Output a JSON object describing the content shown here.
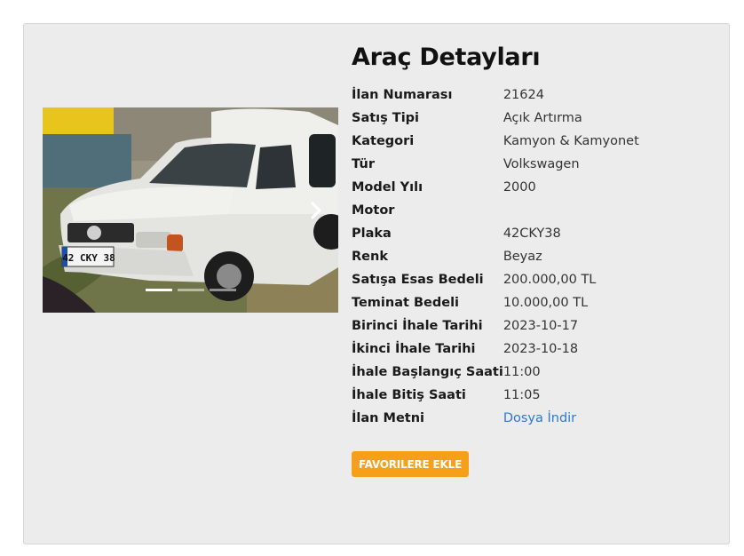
{
  "vehicle": {
    "title": "Araç Detayları",
    "image_alt": "Beyaz Volkswagen kamyonet",
    "carousel": {
      "slide_count": 3,
      "active_index": 0
    },
    "specs": [
      {
        "label": "İlan Numarası",
        "value": "21624"
      },
      {
        "label": "Satış Tipi",
        "value": "Açık Artırma"
      },
      {
        "label": "Kategori",
        "value": "Kamyon & Kamyonet"
      },
      {
        "label": "Tür",
        "value": "Volkswagen"
      },
      {
        "label": "Model Yılı",
        "value": "2000"
      },
      {
        "label": "Motor",
        "value": ""
      },
      {
        "label": "Plaka",
        "value": "42CKY38"
      },
      {
        "label": "Renk",
        "value": "Beyaz"
      },
      {
        "label": "Satışa Esas Bedeli",
        "value": "200.000,00 TL"
      },
      {
        "label": "Teminat Bedeli",
        "value": "10.000,00 TL"
      },
      {
        "label": "Birinci İhale Tarihi",
        "value": "2023-10-17"
      },
      {
        "label": "İkinci İhale Tarihi",
        "value": "2023-10-18"
      },
      {
        "label": "İhale Başlangıç Saati",
        "value": "11:00"
      },
      {
        "label": "İhale Bitiş Saati",
        "value": "11:05"
      },
      {
        "label": "İlan Metni",
        "value": "Dosya İndir"
      }
    ],
    "plate_text": "42 CKY 38",
    "favorite_button": "FAVORILERE EKLE"
  },
  "colors": {
    "accent": "#f6a019",
    "link": "#2a7ad2",
    "card_bg": "#ececec"
  },
  "icons": {
    "next": "chevron-right-icon"
  }
}
